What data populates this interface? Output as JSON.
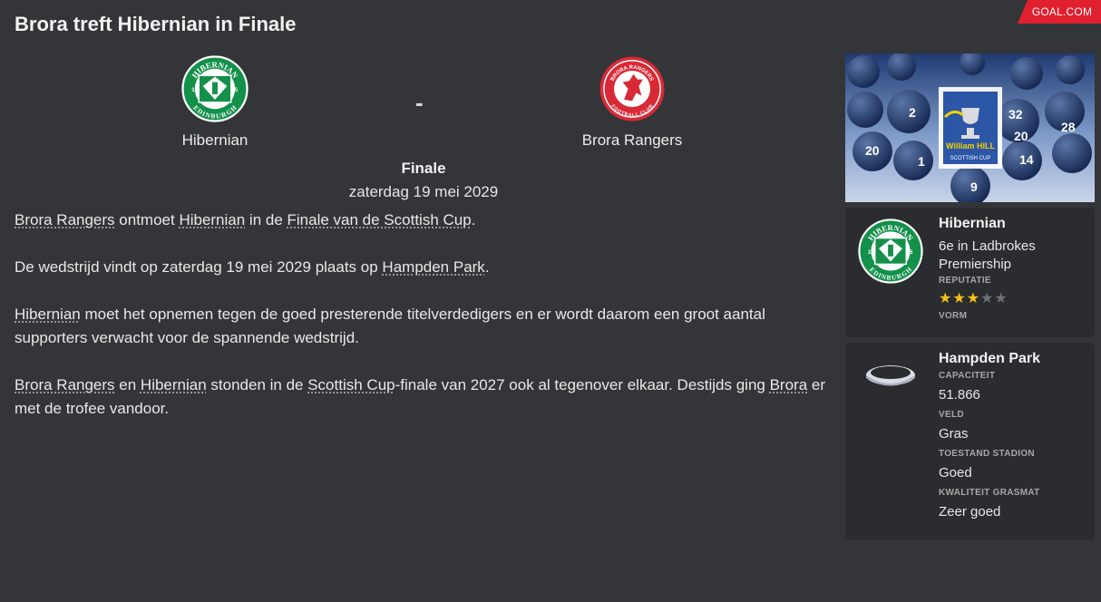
{
  "source_tag": "GOAL.COM",
  "title": "Brora treft Hibernian in Finale",
  "match": {
    "home": "Hibernian",
    "separator": "-",
    "away": "Brora Rangers",
    "stage": "Finale",
    "date": "zaterdag 19 mei 2029"
  },
  "crest_text": {
    "hibernian_top": "HIBERNIAN",
    "hibernian_bottom": "EDINBURGH",
    "hibernian_left": "18",
    "hibernian_right": "75",
    "brora_top": "BRORA RANGERS",
    "brora_bottom": "FOOTBALL CLUB"
  },
  "article": {
    "p1": {
      "a": "Brora Rangers",
      "b": " ontmoet ",
      "c": "Hibernian",
      "d": " in de ",
      "e": "Finale van de Scottish Cup",
      "f": "."
    },
    "p2": {
      "a": "De wedstrijd vindt op zaterdag 19 mei 2029 plaats op ",
      "b": "Hampden Park",
      "c": "."
    },
    "p3": {
      "a": "Hibernian",
      "b": " moet het opnemen tegen de goed presterende titelverdedigers en er wordt daarom een groot aantal supporters verwacht voor de spannende wedstrijd."
    },
    "p4": {
      "a": "Brora Rangers",
      "b": " en ",
      "c": "Hibernian",
      "d": " stonden in de ",
      "e": "Scottish Cup",
      "f": "-finale van 2027 ook al tegenover elkaar. Destijds ging ",
      "g": "Brora",
      "h": " er met de trofee vandoor."
    }
  },
  "banner": {
    "sponsor": "William HILL",
    "cup": "SCOTTISH CUP",
    "ball_numbers": [
      "2",
      "20",
      "1",
      "9",
      "32",
      "20",
      "14",
      "28"
    ]
  },
  "team_card": {
    "name": "Hibernian",
    "position": "6e in Ladbrokes Premiership",
    "reputation_label": "REPUTATIE",
    "reputation_stars": 3,
    "reputation_max": 5,
    "form_label": "VORM"
  },
  "stadium_card": {
    "name": "Hampden Park",
    "capacity_label": "CAPACITEIT",
    "capacity": "51.866",
    "pitch_label": "VELD",
    "pitch": "Gras",
    "condition_label": "TOESTAND STADION",
    "condition": "Goed",
    "grass_label": "KWALITEIT GRASMAT",
    "grass": "Zeer goed"
  },
  "colors": {
    "background": "#343538",
    "card": "#2b2c2f",
    "accent_red": "#e0202e",
    "hibs_green": "#13904a",
    "brora_red": "#d82a36",
    "star_gold": "#f3c316"
  }
}
